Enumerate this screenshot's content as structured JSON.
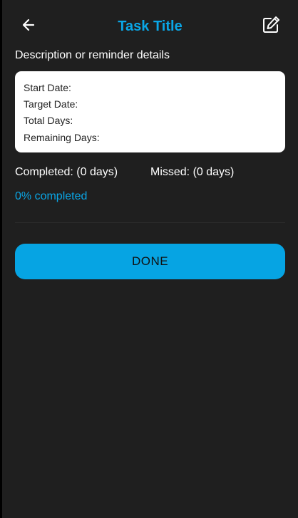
{
  "header": {
    "title": "Task Title",
    "back_icon": "arrow-left-icon",
    "edit_icon": "edit-pencil-icon"
  },
  "description": "Description or reminder details",
  "details": {
    "start_date_label": "Start Date:",
    "target_date_label": "Target Date:",
    "total_days_label": "Total Days:",
    "remaining_days_label": "Remaining Days:"
  },
  "stats": {
    "completed": "Completed: (0 days)",
    "missed": "Missed: (0 days)",
    "progress_text": "0% completed",
    "progress_fraction": 0
  },
  "actions": {
    "done_label": "DONE"
  },
  "colors": {
    "accent": "#0aa6e6",
    "background": "#1f1f1f",
    "card": "#ffffff",
    "button": "#06a4e3"
  }
}
